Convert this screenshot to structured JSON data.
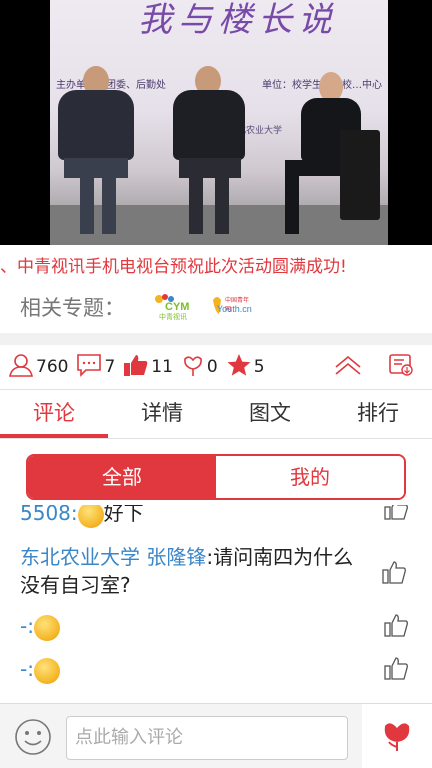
{
  "video": {
    "banner_title": "我与楼长说",
    "banner_sub_left": "主办单位：团委、后勤处",
    "banner_sub_right": "单位：校学生会、校…中心",
    "banner_small": "东北农业大学"
  },
  "marquee_text": "、中青视讯手机电视台预祝此次活动圆满成功!",
  "topics": {
    "label": "相关专题：",
    "logo1_text": "CYM",
    "logo1_sub": "中青视讯",
    "logo2_text": "Youth.cn",
    "logo2_sub": "中国青年网"
  },
  "stats": {
    "views": "760",
    "comments": "7",
    "likes": "11",
    "flowers": "0",
    "stars": "5"
  },
  "tabs": [
    "评论",
    "详情",
    "图文",
    "排行"
  ],
  "segment": {
    "all": "全部",
    "mine": "我的"
  },
  "comments": {
    "partial_top": "5508:",
    "partial_top_text": "好下",
    "c1_user": "东北农业大学 张隆锋",
    "c1_text": ":请问南四为什么没有自习室?",
    "c2_user": "-:",
    "c3_user": "-:"
  },
  "bottom": {
    "placeholder": "点此输入评论"
  },
  "colors": {
    "accent": "#e0383e",
    "link": "#3a86c8"
  }
}
